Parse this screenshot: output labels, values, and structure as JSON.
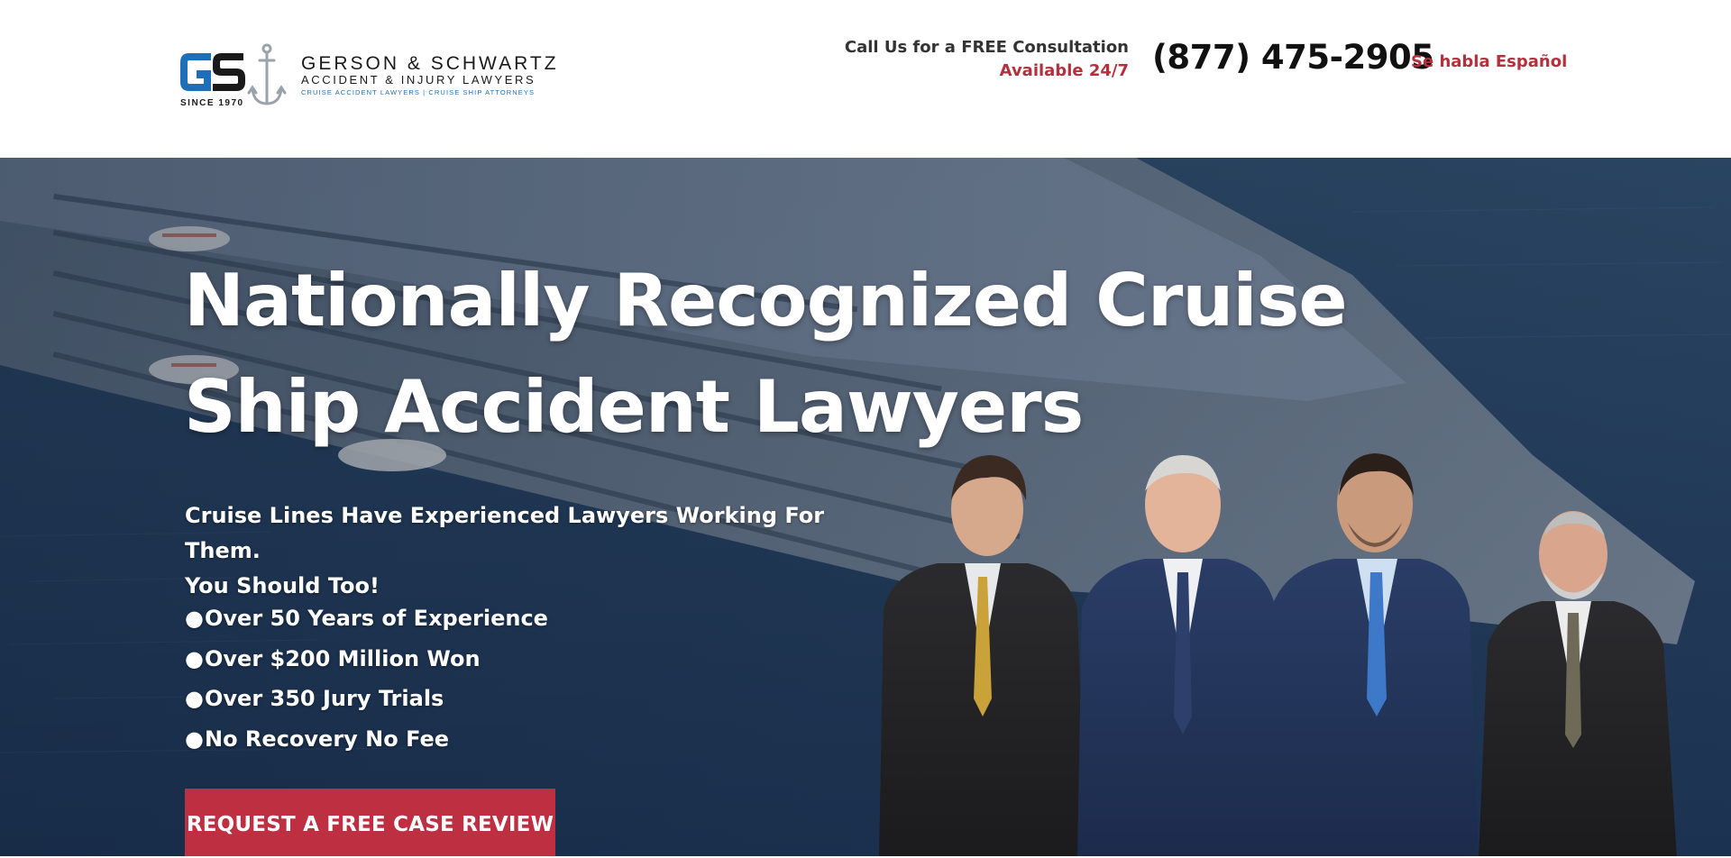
{
  "header": {
    "logo": {
      "initials": "GS",
      "firm_name": "GERSON & SCHWARTZ",
      "firm_subtitle": "ACCIDENT & INJURY LAWYERS",
      "tagline": "CRUISE ACCIDENT LAWYERS | CRUISE SHIP ATTORNEYS",
      "since": "SINCE 1970"
    },
    "contact": {
      "call_text": "Call Us for a FREE Consultation",
      "availability": "Available 24/7",
      "phone": "(877) 475-2905",
      "spanish_link": "Se habla Español"
    }
  },
  "hero": {
    "title_line1": "Nationally Recognized Cruise",
    "title_line2": "Ship Accident Lawyers",
    "subtitle_line1": "Cruise Lines Have Experienced Lawyers Working For Them.",
    "subtitle_line2": "You Should Too!",
    "bullets": [
      "Over 50 Years of Experience",
      "Over $200 Million Won",
      "Over 350 Jury Trials",
      "No Recovery No Fee"
    ],
    "cta_label": "REQUEST A FREE CASE REVIEW"
  },
  "colors": {
    "accent_red": "#be2f42",
    "logo_blue": "#1e6fb8",
    "hero_navy": "#263f5c"
  },
  "icons": {
    "logo_mark": "anchor-icon"
  }
}
